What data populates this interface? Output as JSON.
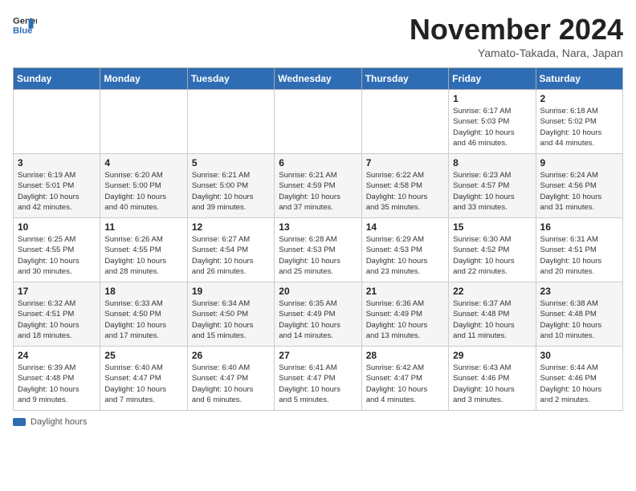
{
  "logo": {
    "line1": "General",
    "line2": "Blue"
  },
  "title": "November 2024",
  "location": "Yamato-Takada, Nara, Japan",
  "days_of_week": [
    "Sunday",
    "Monday",
    "Tuesday",
    "Wednesday",
    "Thursday",
    "Friday",
    "Saturday"
  ],
  "weeks": [
    [
      {
        "day": "",
        "info": ""
      },
      {
        "day": "",
        "info": ""
      },
      {
        "day": "",
        "info": ""
      },
      {
        "day": "",
        "info": ""
      },
      {
        "day": "",
        "info": ""
      },
      {
        "day": "1",
        "info": "Sunrise: 6:17 AM\nSunset: 5:03 PM\nDaylight: 10 hours\nand 46 minutes."
      },
      {
        "day": "2",
        "info": "Sunrise: 6:18 AM\nSunset: 5:02 PM\nDaylight: 10 hours\nand 44 minutes."
      }
    ],
    [
      {
        "day": "3",
        "info": "Sunrise: 6:19 AM\nSunset: 5:01 PM\nDaylight: 10 hours\nand 42 minutes."
      },
      {
        "day": "4",
        "info": "Sunrise: 6:20 AM\nSunset: 5:00 PM\nDaylight: 10 hours\nand 40 minutes."
      },
      {
        "day": "5",
        "info": "Sunrise: 6:21 AM\nSunset: 5:00 PM\nDaylight: 10 hours\nand 39 minutes."
      },
      {
        "day": "6",
        "info": "Sunrise: 6:21 AM\nSunset: 4:59 PM\nDaylight: 10 hours\nand 37 minutes."
      },
      {
        "day": "7",
        "info": "Sunrise: 6:22 AM\nSunset: 4:58 PM\nDaylight: 10 hours\nand 35 minutes."
      },
      {
        "day": "8",
        "info": "Sunrise: 6:23 AM\nSunset: 4:57 PM\nDaylight: 10 hours\nand 33 minutes."
      },
      {
        "day": "9",
        "info": "Sunrise: 6:24 AM\nSunset: 4:56 PM\nDaylight: 10 hours\nand 31 minutes."
      }
    ],
    [
      {
        "day": "10",
        "info": "Sunrise: 6:25 AM\nSunset: 4:55 PM\nDaylight: 10 hours\nand 30 minutes."
      },
      {
        "day": "11",
        "info": "Sunrise: 6:26 AM\nSunset: 4:55 PM\nDaylight: 10 hours\nand 28 minutes."
      },
      {
        "day": "12",
        "info": "Sunrise: 6:27 AM\nSunset: 4:54 PM\nDaylight: 10 hours\nand 26 minutes."
      },
      {
        "day": "13",
        "info": "Sunrise: 6:28 AM\nSunset: 4:53 PM\nDaylight: 10 hours\nand 25 minutes."
      },
      {
        "day": "14",
        "info": "Sunrise: 6:29 AM\nSunset: 4:53 PM\nDaylight: 10 hours\nand 23 minutes."
      },
      {
        "day": "15",
        "info": "Sunrise: 6:30 AM\nSunset: 4:52 PM\nDaylight: 10 hours\nand 22 minutes."
      },
      {
        "day": "16",
        "info": "Sunrise: 6:31 AM\nSunset: 4:51 PM\nDaylight: 10 hours\nand 20 minutes."
      }
    ],
    [
      {
        "day": "17",
        "info": "Sunrise: 6:32 AM\nSunset: 4:51 PM\nDaylight: 10 hours\nand 18 minutes."
      },
      {
        "day": "18",
        "info": "Sunrise: 6:33 AM\nSunset: 4:50 PM\nDaylight: 10 hours\nand 17 minutes."
      },
      {
        "day": "19",
        "info": "Sunrise: 6:34 AM\nSunset: 4:50 PM\nDaylight: 10 hours\nand 15 minutes."
      },
      {
        "day": "20",
        "info": "Sunrise: 6:35 AM\nSunset: 4:49 PM\nDaylight: 10 hours\nand 14 minutes."
      },
      {
        "day": "21",
        "info": "Sunrise: 6:36 AM\nSunset: 4:49 PM\nDaylight: 10 hours\nand 13 minutes."
      },
      {
        "day": "22",
        "info": "Sunrise: 6:37 AM\nSunset: 4:48 PM\nDaylight: 10 hours\nand 11 minutes."
      },
      {
        "day": "23",
        "info": "Sunrise: 6:38 AM\nSunset: 4:48 PM\nDaylight: 10 hours\nand 10 minutes."
      }
    ],
    [
      {
        "day": "24",
        "info": "Sunrise: 6:39 AM\nSunset: 4:48 PM\nDaylight: 10 hours\nand 9 minutes."
      },
      {
        "day": "25",
        "info": "Sunrise: 6:40 AM\nSunset: 4:47 PM\nDaylight: 10 hours\nand 7 minutes."
      },
      {
        "day": "26",
        "info": "Sunrise: 6:40 AM\nSunset: 4:47 PM\nDaylight: 10 hours\nand 6 minutes."
      },
      {
        "day": "27",
        "info": "Sunrise: 6:41 AM\nSunset: 4:47 PM\nDaylight: 10 hours\nand 5 minutes."
      },
      {
        "day": "28",
        "info": "Sunrise: 6:42 AM\nSunset: 4:47 PM\nDaylight: 10 hours\nand 4 minutes."
      },
      {
        "day": "29",
        "info": "Sunrise: 6:43 AM\nSunset: 4:46 PM\nDaylight: 10 hours\nand 3 minutes."
      },
      {
        "day": "30",
        "info": "Sunrise: 6:44 AM\nSunset: 4:46 PM\nDaylight: 10 hours\nand 2 minutes."
      }
    ]
  ],
  "legend": {
    "daylight_label": "Daylight hours"
  },
  "accent_color": "#2e6db4"
}
